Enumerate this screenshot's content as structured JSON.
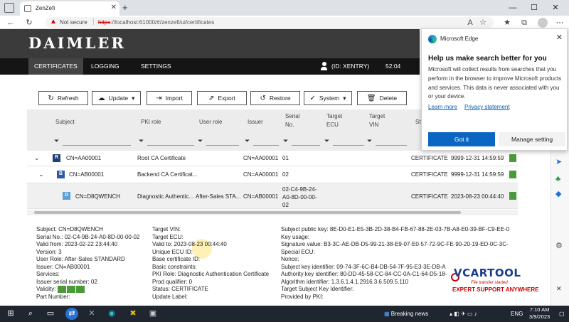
{
  "browser": {
    "tab_title": "ZenZefi",
    "not_secure": "Not secure",
    "url_scheme": "https",
    "url_rest": "://localhost:61000/#/zenzefi/ui/certificates"
  },
  "app": {
    "brand": "DAIMLER",
    "nav": [
      "CERTIFICATES",
      "LOGGING",
      "SETTINGS"
    ],
    "user": "(ID: XENTRY)",
    "timer": "52:04"
  },
  "toolbar": {
    "refresh": "Refresh",
    "update": "Update",
    "import": "Import",
    "export": "Export",
    "restore": "Restore",
    "system": "System",
    "delete": "Delete"
  },
  "table": {
    "headers": {
      "subject": "Subject",
      "pki_role": "PKI role",
      "user_role": "User role",
      "issuer": "Issuer",
      "serial_1": "Serial",
      "serial_2": "No.",
      "target_ecu_1": "Target",
      "target_ecu_2": "ECU",
      "target_vin_1": "Target",
      "target_vin_2": "VIN",
      "status": "St"
    },
    "rows": [
      {
        "icon": "R",
        "subject": "CN=AA00001",
        "pki_role": "Root CA Certificate",
        "user_role": "",
        "issuer": "CN=AA00001",
        "serial": "01",
        "status": "CERTIFICATE",
        "valid_to": "9999-12-31 14:59:59"
      },
      {
        "icon": "B",
        "subject": "CN=AB00001",
        "pki_role": "Backend CA Certificat...",
        "user_role": "",
        "issuer": "CN=AA00001",
        "serial": "02",
        "status": "CERTIFICATE",
        "valid_to": "9999-12-31 14:59:59"
      },
      {
        "icon": "D",
        "subject": "CN=D8QWENCH",
        "pki_role": "Diagnostic Authentic...",
        "user_role": "After-Sales STA...",
        "issuer": "CN=AB00001",
        "serial_lines": [
          "02-C4-9B-24-",
          "A0-8D-00-00-",
          "02"
        ],
        "status": "CERTIFICATE",
        "valid_to": "2023-08-23 00:44:40"
      }
    ]
  },
  "details": {
    "col1": [
      "Subject: CN=D8QWENCH",
      "Serial No.: 02-C4-9B-24-A0-8D-00-00-02",
      "Valid from: 2023-02-22 23:44:40",
      "Version: 3",
      "User Role: After-Sales STANDARD",
      "Issuer: CN=AB00001",
      "Services:",
      "Issuer serial number: 02",
      "Validity:",
      "Part Number:"
    ],
    "col2": [
      "Target VIN:",
      "Target ECU:",
      "Valid to: 2023-08-23 00:44:40",
      "Unique ECU ID:",
      "Base certificate ID:",
      "Basic constraints:",
      "PKI Role: Diagnostic Authentication Certificate",
      "Prod qualifier: 0",
      "Status: CERTIFICATE",
      "Update Label:"
    ],
    "col3": [
      "Subject public key: 8E-D0-E1-E5-3B-2D-38-B4-FB-67-88-2E-03-7B-A8-E0-39-BF-C9-EE-0",
      "Key usage:",
      "Signature value: B3-3C-AE-DB-D5-99-21-38-E9-07-E0-57-72-9C-FE-90-20-19-ED-0C-3C-",
      "Special ECU:",
      "Nonce:",
      "Subject key identifier: 09-74-3F-6C-B4-DB-54-7F-95-E3-3E-DB-A",
      "Authority key identifier: 80-DD-45-58-CC-84-CC-0A-C1-64-D5-18-",
      "Algorithm identifier: 1.3.6.1.4.1.2916.3.6.509.5.110",
      "Target Subject Key Identifier:",
      "Provided by PKI:"
    ]
  },
  "edge_popup": {
    "brand": "Microsoft Edge",
    "heading": "Help us make search better for you",
    "body": "Microsoft will collect results from searches that you perform in the browser to improve Microsoft products and services. This data is never associated with you or your device.",
    "link_learn": "Learn more",
    "link_privacy": "Privacy statement",
    "got_it": "Got it",
    "manage": "Manage setting"
  },
  "watermark": {
    "title": "VCARTOOL",
    "sub": "File transfer started",
    "tag": "EXPERT SUPPORT ANYWHERE"
  },
  "taskbar": {
    "news": "Breaking news",
    "lang": "ENG",
    "time": "7:10 AM",
    "date": "3/9/2023"
  },
  "colors": {
    "header": "#3b3b3b",
    "navbar": "#151515",
    "accent_green": "#4a9a3a",
    "edge_blue": "#0b66c3"
  }
}
